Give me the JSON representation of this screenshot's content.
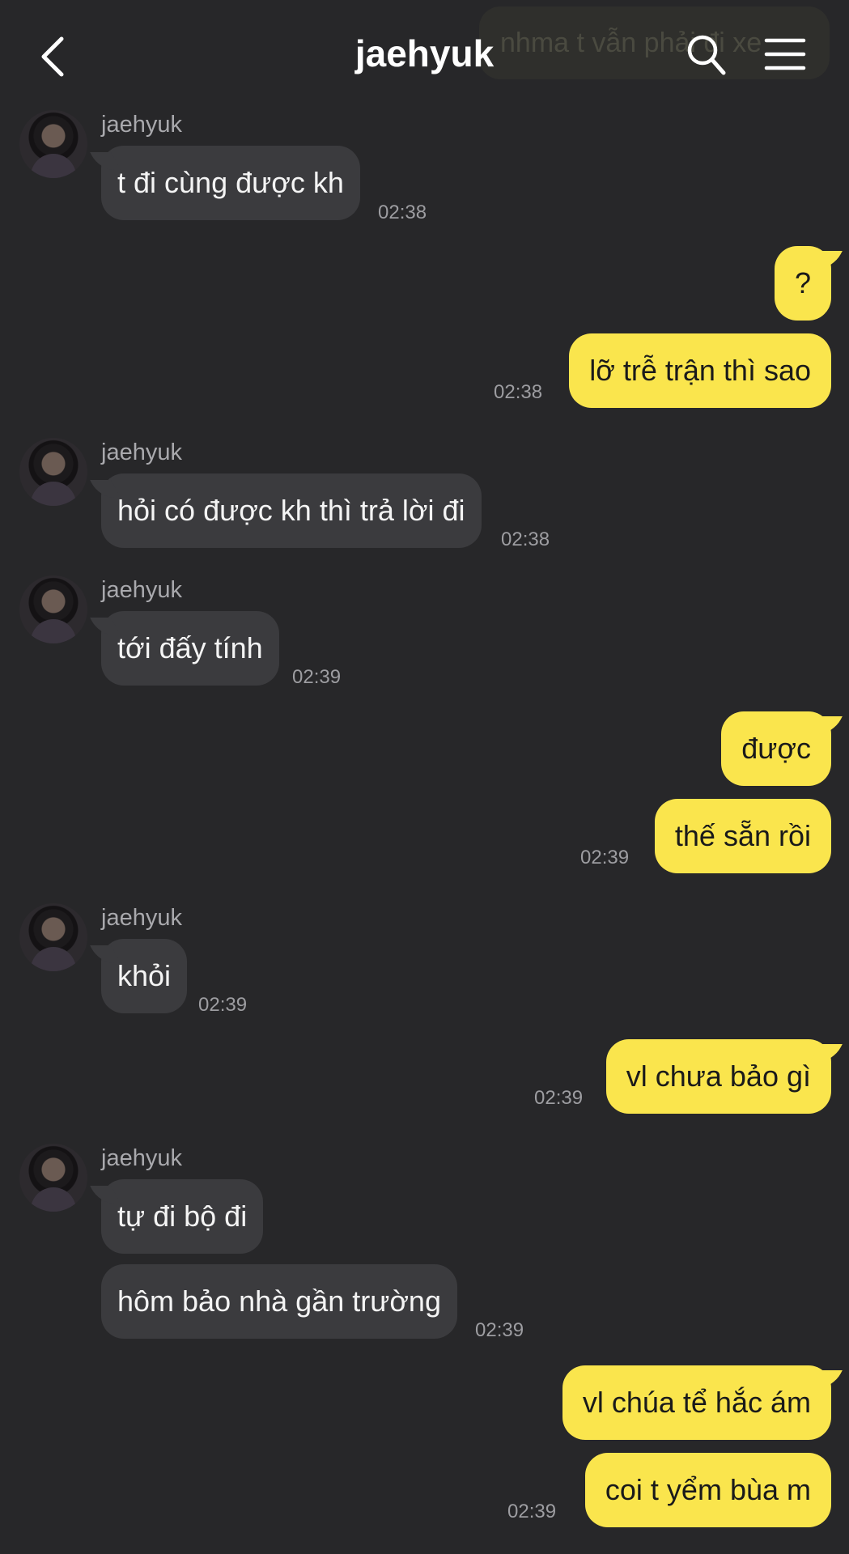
{
  "header": {
    "title": "jaehyuk",
    "back_icon": "chevron-left-icon",
    "search_icon": "search-icon",
    "menu_icon": "hamburger-menu-icon",
    "pinned_preview": "nhma t vẫn phải đi xe"
  },
  "colors": {
    "background": "#272729",
    "received_bubble": "#3b3b3e",
    "sent_bubble": "#fae54d"
  },
  "messages": [
    {
      "sender": "jaehyuk",
      "text": "t đi cùng được kh",
      "time": "02:38"
    },
    {
      "text": "?"
    },
    {
      "text": "lỡ trễ trận thì sao",
      "time": "02:38"
    },
    {
      "sender": "jaehyuk",
      "text": "hỏi có được kh thì trả lời đi",
      "time": "02:38"
    },
    {
      "sender": "jaehyuk",
      "text": "tới đấy tính",
      "time": "02:39"
    },
    {
      "text": "được"
    },
    {
      "text": "thế sẵn rồi",
      "time": "02:39"
    },
    {
      "sender": "jaehyuk",
      "text": "khỏi",
      "time": "02:39"
    },
    {
      "text": "vl chưa bảo gì",
      "time": "02:39"
    },
    {
      "sender": "jaehyuk",
      "text": "tự đi bộ đi"
    },
    {
      "text": "hôm bảo nhà gần trường",
      "time": "02:39"
    },
    {
      "text": "vl chúa tể hắc ám"
    },
    {
      "text": "coi t yểm bùa m",
      "time": "02:39"
    }
  ]
}
